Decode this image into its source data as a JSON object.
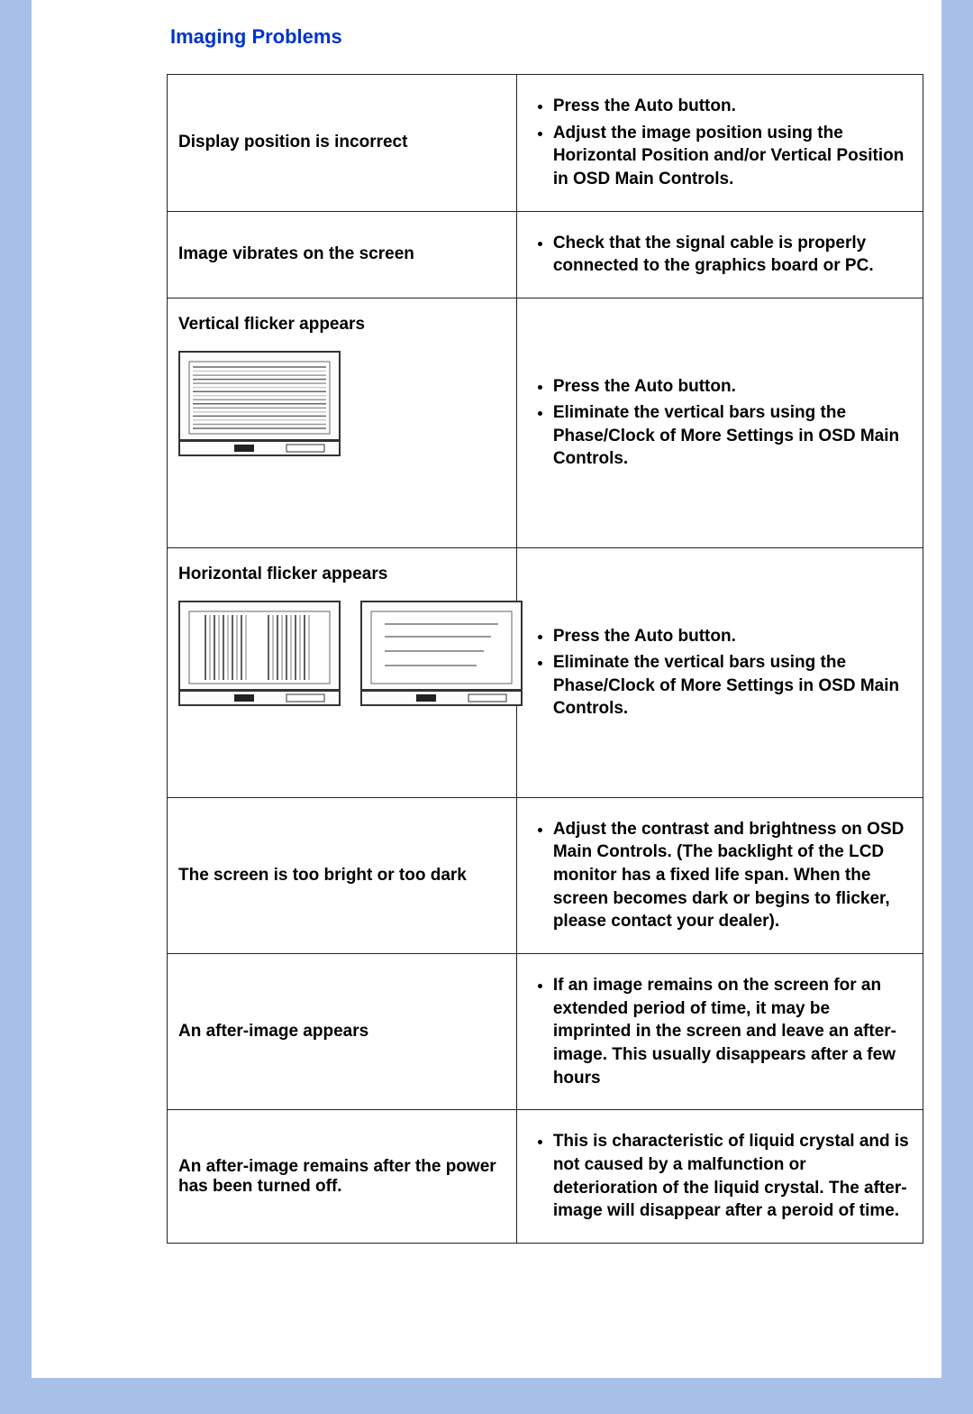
{
  "heading": "Imaging Problems",
  "rows": [
    {
      "problem": "Display position is incorrect",
      "solutions": [
        "Press the Auto button.",
        "Adjust the image position using the Horizontal Position and/or Vertical Position in OSD Main Controls."
      ],
      "illustration": null,
      "vcenter": true
    },
    {
      "problem": "Image vibrates on the screen",
      "solutions": [
        "Check that the signal cable is properly connected to the graphics board or PC."
      ],
      "illustration": null,
      "vcenter": true
    },
    {
      "problem": "Vertical flicker appears",
      "solutions": [
        "Press the Auto button.",
        "Eliminate the vertical bars using the Phase/Clock of More Settings in OSD Main Controls."
      ],
      "illustration": "vflicker",
      "vcenter": false
    },
    {
      "problem": "Horizontal flicker appears",
      "solutions": [
        "Press the Auto button.",
        "Eliminate the vertical bars using the Phase/Clock of More Settings in OSD Main Controls."
      ],
      "illustration": "hflicker",
      "vcenter": false
    },
    {
      "problem": "The screen is too bright or too dark",
      "solutions": [
        "Adjust the contrast and brightness on OSD Main Controls. (The backlight of the LCD monitor has a fixed life span. When the screen becomes dark or begins to flicker, please contact your dealer)."
      ],
      "illustration": null,
      "vcenter": true
    },
    {
      "problem": "An after-image appears",
      "solutions": [
        "If an image remains on the screen for an extended period of time, it may be imprinted in the screen and leave an after-image. This usually disappears after a few hours"
      ],
      "illustration": null,
      "vcenter": true
    },
    {
      "problem": "An after-image remains after the power has been turned off.",
      "solutions": [
        "This is characteristic of liquid crystal and is not caused by a malfunction or deterioration of the liquid crystal. The after-image will disappear after a peroid of time."
      ],
      "illustration": null,
      "vcenter": true
    }
  ]
}
